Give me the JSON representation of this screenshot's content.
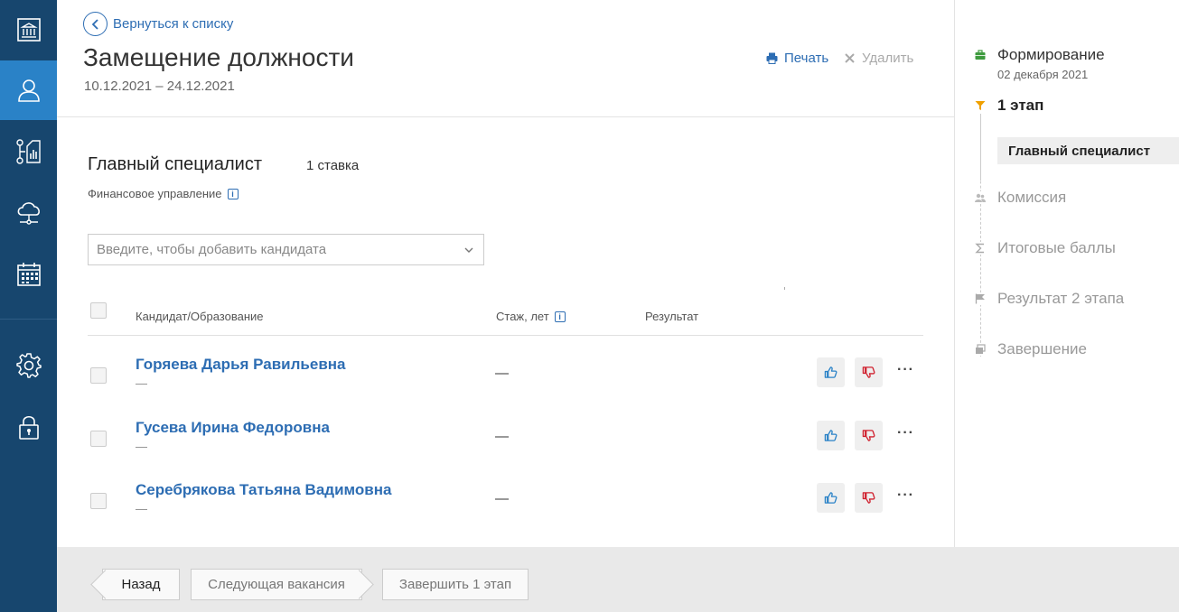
{
  "nav": {
    "items": [
      {
        "icon": "building-icon"
      },
      {
        "icon": "user-icon",
        "active": true
      },
      {
        "icon": "workflow-chart-icon"
      },
      {
        "icon": "cloud-network-icon"
      },
      {
        "icon": "calendar-icon"
      },
      {
        "icon": "gear-icon"
      },
      {
        "icon": "lock-icon"
      }
    ]
  },
  "header": {
    "back_label": "Вернуться к списку",
    "title": "Замещение должности",
    "dates": "10.12.2021 – 24.12.2021",
    "print_label": "Печать",
    "delete_label": "Удалить"
  },
  "vacancy": {
    "title": "Главный специалист",
    "rate": "1 ставка",
    "department": "Финансовое управление",
    "info_mark": "i",
    "candidate_placeholder": "Введите, чтобы добавить кандидата"
  },
  "table": {
    "columns": {
      "candidate": "Кандидат/Образование",
      "experience": "Стаж, лет",
      "result": "Результат"
    },
    "rows": [
      {
        "name": "Горяева Дарья Равильевна",
        "education": "—",
        "experience": "—"
      },
      {
        "name": "Гусева Ирина Федоровна",
        "education": "—",
        "experience": "—"
      },
      {
        "name": "Серебрякова Татьяна Вадимовна",
        "education": "—",
        "experience": "—"
      }
    ],
    "more_label": "···"
  },
  "footer": {
    "back_label": "Назад",
    "next_label": "Следующая вакансия",
    "finish_label": "Завершить 1 этап"
  },
  "steps": {
    "formation": {
      "label": "Формирование",
      "date": "02 декабря 2021"
    },
    "stage1": {
      "label": "1 этап",
      "active_item": "Главный специалист"
    },
    "commission": {
      "label": "Комиссия"
    },
    "total": {
      "label": "Итоговые баллы"
    },
    "stage2": {
      "label": "Результат 2 этапа"
    },
    "finish": {
      "label": "Завершение"
    }
  },
  "colors": {
    "rail": "#17466e",
    "rail_active": "#2a82c7",
    "link": "#2d6db3",
    "thumb_up": "#2a82c7",
    "thumb_down": "#d0202e",
    "step_green": "#3e9b3e",
    "step_orange": "#f0a000"
  }
}
